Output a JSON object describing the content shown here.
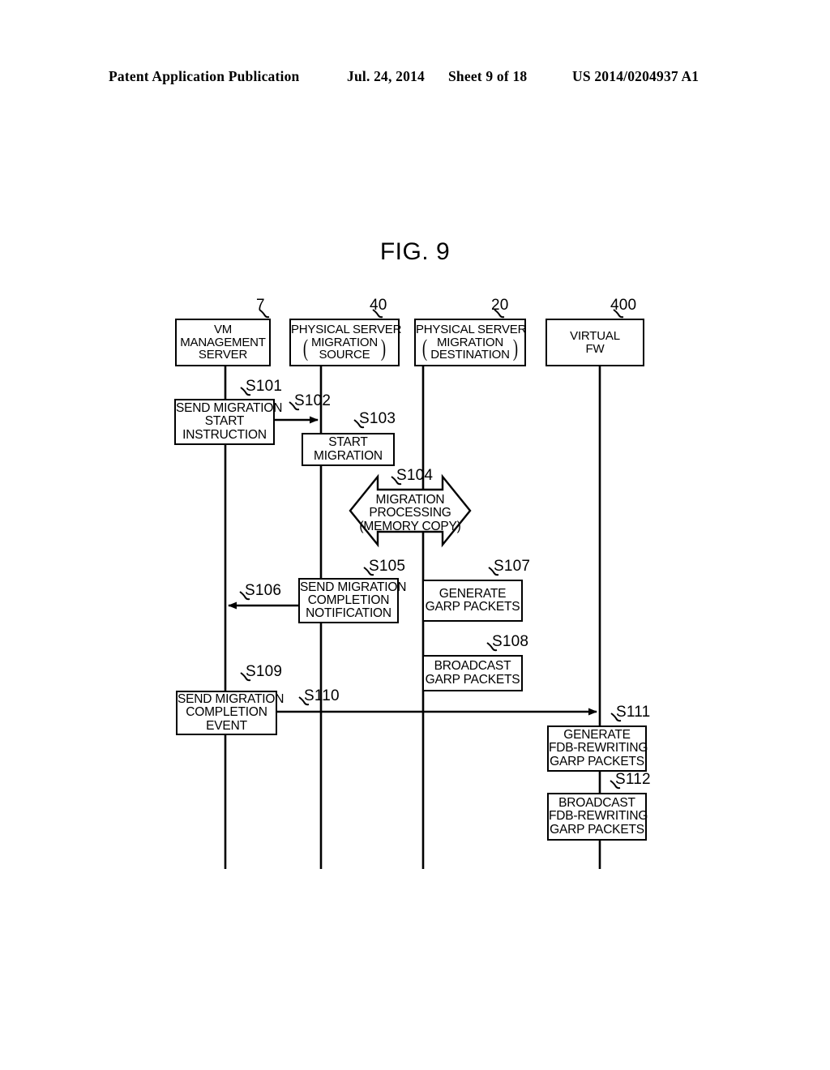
{
  "header": {
    "publication": "Patent Application Publication",
    "date": "Jul. 24, 2014",
    "sheet": "Sheet 9 of 18",
    "patent_number": "US 2014/0204937 A1"
  },
  "figure": {
    "title": "FIG. 9"
  },
  "lifelines": [
    {
      "id": "vm-management-server",
      "ref": "7",
      "lines": [
        "VM",
        "MANAGEMENT",
        "SERVER"
      ],
      "paren": false
    },
    {
      "id": "physical-server-migration-source",
      "ref": "40",
      "lines": [
        "PHYSICAL SERVER"
      ],
      "paren": true,
      "paren_lines": [
        "MIGRATION",
        "SOURCE"
      ]
    },
    {
      "id": "physical-server-migration-destination",
      "ref": "20",
      "lines": [
        "PHYSICAL SERVER"
      ],
      "paren": true,
      "paren_lines": [
        "MIGRATION",
        "DESTINATION"
      ]
    },
    {
      "id": "virtual-fw",
      "ref": "400",
      "lines": [
        "VIRTUAL",
        "FW"
      ],
      "paren": false
    }
  ],
  "steps": {
    "s101": {
      "tag": "S101",
      "lines": [
        "SEND MIGRATION",
        "START",
        "INSTRUCTION"
      ]
    },
    "s102": {
      "tag": "S102"
    },
    "s103": {
      "tag": "S103",
      "lines": [
        "START",
        "MIGRATION"
      ]
    },
    "s104": {
      "tag": "S104",
      "lines": [
        "MIGRATION",
        "PROCESSING",
        "(MEMORY COPY)"
      ]
    },
    "s105": {
      "tag": "S105",
      "lines": [
        "SEND MIGRATION",
        "COMPLETION",
        "NOTIFICATION"
      ]
    },
    "s106": {
      "tag": "S106"
    },
    "s107": {
      "tag": "S107",
      "lines": [
        "GENERATE",
        "GARP PACKETS"
      ]
    },
    "s108": {
      "tag": "S108",
      "lines": [
        "BROADCAST",
        "GARP PACKETS"
      ]
    },
    "s109": {
      "tag": "S109",
      "lines": [
        "SEND MIGRATION",
        "COMPLETION",
        "EVENT"
      ]
    },
    "s110": {
      "tag": "S110"
    },
    "s111": {
      "tag": "S111",
      "lines": [
        "GENERATE",
        "FDB-REWRITING",
        "GARP PACKETS"
      ]
    },
    "s112": {
      "tag": "S112",
      "lines": [
        "BROADCAST",
        "FDB-REWRITING",
        "GARP PACKETS"
      ]
    }
  },
  "colors": {
    "ink": "#000000",
    "paper": "#ffffff"
  }
}
